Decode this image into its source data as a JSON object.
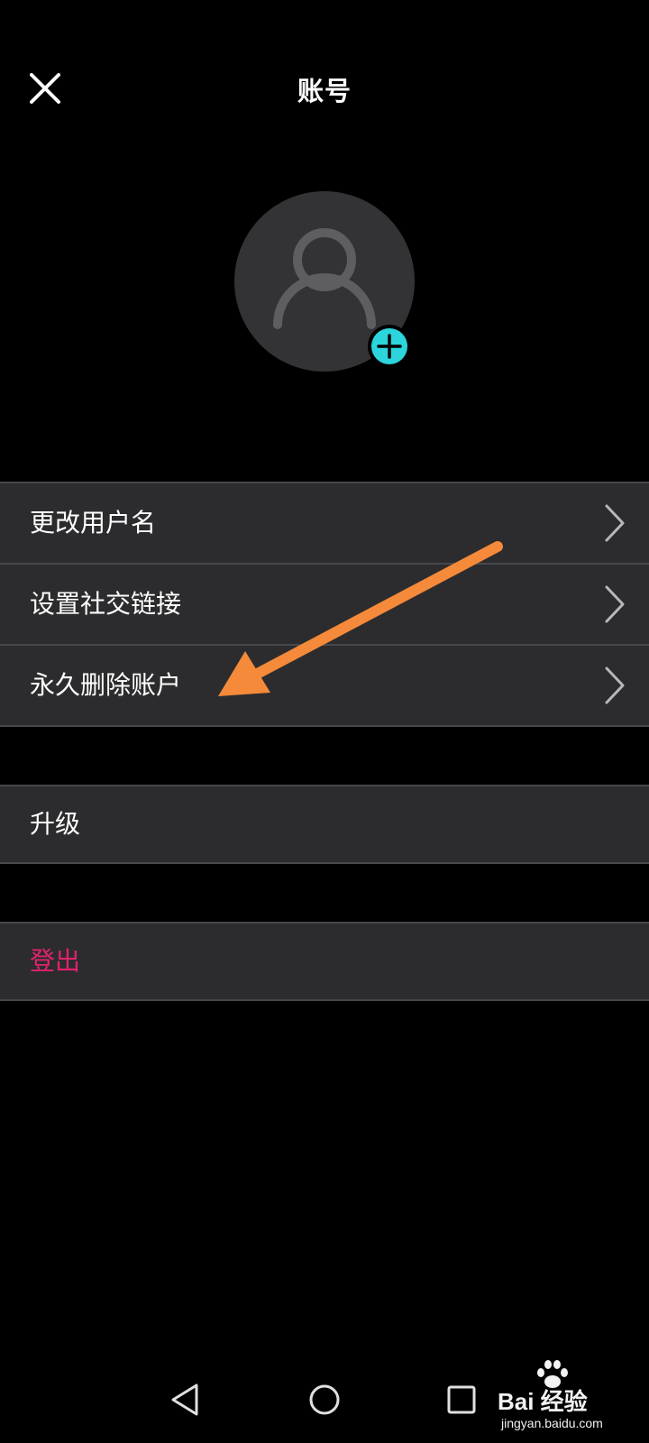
{
  "header": {
    "title": "账号",
    "close_icon": "close-icon"
  },
  "avatar": {
    "placeholder_icon": "person-icon",
    "add_icon": "add-icon",
    "add_color": "#2cd4dc"
  },
  "settings_group": {
    "items": [
      {
        "label": "更改用户名",
        "icon": "chevron-right-icon"
      },
      {
        "label": "设置社交链接",
        "icon": "chevron-right-icon"
      },
      {
        "label": "永久删除账户",
        "icon": "chevron-right-icon"
      }
    ]
  },
  "upgrade_group": {
    "label": "升级"
  },
  "logout_group": {
    "label": "登出",
    "color": "#e3226d"
  },
  "annotation": {
    "icon": "annotation-arrow-icon",
    "color": "#f58a3a"
  },
  "navigation_bar": {
    "back_icon": "triangle-back-icon",
    "home_icon": "circle-home-icon",
    "recents_icon": "square-recents-icon"
  },
  "watermark": {
    "brand": "Bai 经验",
    "url": "jingyan.baidu.com"
  },
  "colors": {
    "background": "#000000",
    "row_background": "#2c2c2e",
    "avatar_background": "#333335",
    "divider": "#48484a"
  }
}
